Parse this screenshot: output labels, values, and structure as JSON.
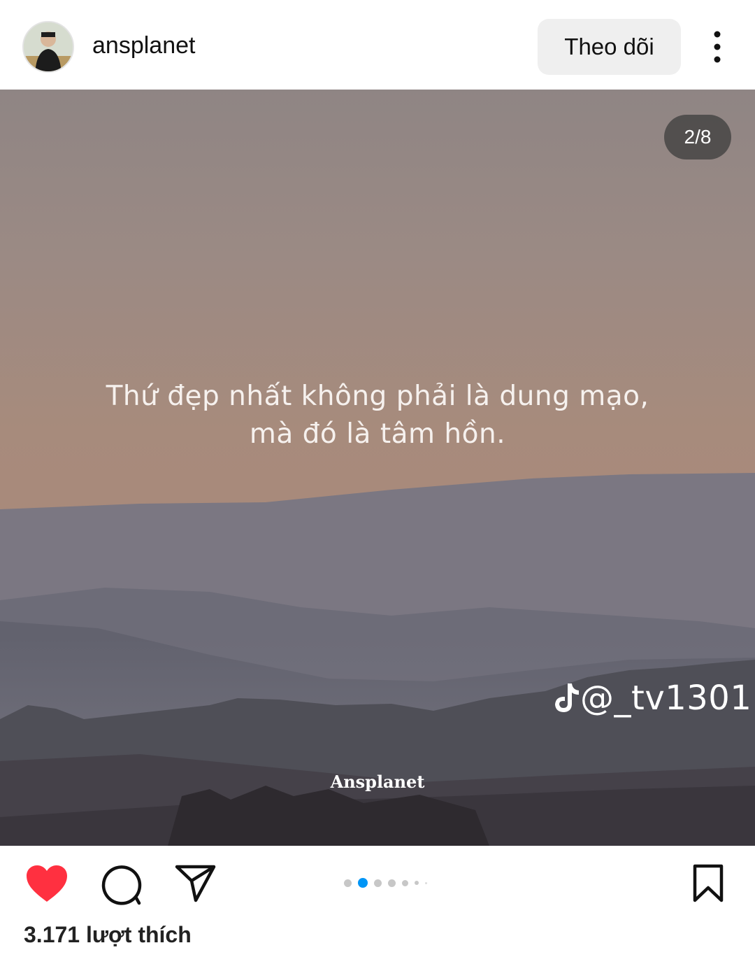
{
  "header": {
    "username": "ansplanet",
    "follow_label": "Theo dõi"
  },
  "post": {
    "counter": "2/8",
    "quote_line1": "Thứ đẹp nhất không phải là dung mạo,",
    "quote_line2": "mà đó là tâm hồn.",
    "watermark": "@_tv1301",
    "brand": "Ansplanet",
    "current_slide": 2,
    "total_slides": 8
  },
  "actions": {
    "liked": true,
    "like_color": "#ff3040"
  },
  "likes": "3.171 lượt thích",
  "icons": [
    "more-vertical-icon",
    "heart-icon",
    "comment-icon",
    "share-icon",
    "bookmark-icon",
    "tiktok-icon"
  ]
}
